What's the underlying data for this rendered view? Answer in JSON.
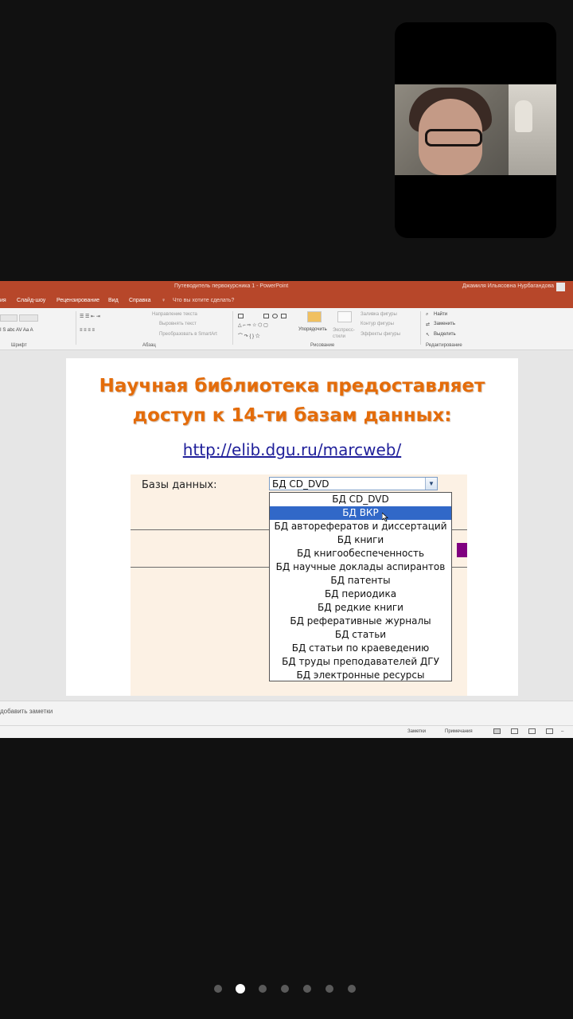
{
  "presentation": {
    "title_bar": "Путеводитель первокурсника 1  -  PowerPoint",
    "user_name": "Джамиля Ильясовна Нурбагандова",
    "menu": [
      "ия",
      "Слайд-шоу",
      "Рецензирование",
      "Вид",
      "Справка"
    ],
    "tell_me": "Что вы хотите сделать?",
    "ribbon": {
      "paragraph_items": [
        "Направление текста",
        "Выровнять текст",
        "Преобразовать в SmartArt"
      ],
      "arrange_label": "Упорядочить",
      "quick_styles_label": "Экспресс-стили",
      "shape_fill": "Заливка фигуры",
      "shape_outline": "Контур фигуры",
      "shape_effects": "Эффекты фигуры",
      "find": "Найти",
      "replace": "Заменить",
      "select": "Выделить",
      "groups": {
        "font": "Шрифт",
        "paragraph": "Абзац",
        "drawing": "Рисование",
        "editing": "Редактирование"
      }
    },
    "slide": {
      "title_line1": "Научная библиотека предоставляет",
      "title_line2": "доступ к 14-ти базам данных:",
      "link": "http://elib.dgu.ru/marcweb/",
      "db_label": "Базы данных:",
      "selected_value": "БД CD_DVD",
      "options": [
        "БД CD_DVD",
        "БД ВКР",
        "БД авторефератов и диссертаций",
        "БД книги",
        "БД книгообеспеченность",
        "БД научные доклады аспирантов",
        "БД патенты",
        "БД периодика",
        "БД редкие книги",
        "БД реферативные журналы",
        "БД статьи",
        "БД статьи по краеведению",
        "БД труды преподавателей ДГУ",
        "БД электронные ресурсы"
      ],
      "highlighted_option": "БД ВКР"
    },
    "notes_placeholder": "добавить заметки",
    "status": {
      "notes": "Заметки",
      "comments": "Примечания"
    }
  },
  "pager": {
    "count": 7,
    "active_index": 1
  },
  "colors": {
    "accent": "#b7472a",
    "slide_title": "#e46c0a",
    "selection": "#3168c8",
    "purple": "#800080"
  }
}
